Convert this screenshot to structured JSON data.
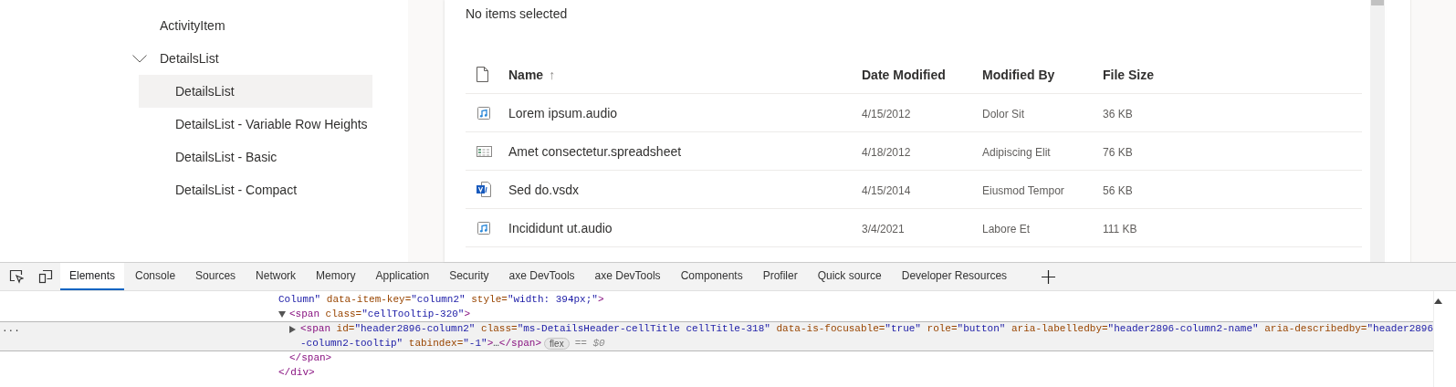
{
  "nav": {
    "items": [
      {
        "label": "ActivityItem",
        "selected": false
      },
      {
        "label": "DetailsList",
        "selected": false,
        "expanded": true,
        "children": [
          {
            "label": "DetailsList",
            "selected": true
          },
          {
            "label": "DetailsList - Variable Row Heights",
            "selected": false
          },
          {
            "label": "DetailsList - Basic",
            "selected": false
          },
          {
            "label": "DetailsList - Compact",
            "selected": false
          }
        ]
      }
    ]
  },
  "content": {
    "selection_status": "No items selected",
    "table": {
      "columns": [
        {
          "label": "Name",
          "sort_glyph": "↑"
        },
        {
          "label": "Date Modified"
        },
        {
          "label": "Modified By"
        },
        {
          "label": "File Size"
        }
      ],
      "rows": [
        {
          "kind": "audio",
          "cells": [
            "Lorem ipsum.audio",
            "4/15/2012",
            "Dolor Sit",
            "36 KB"
          ]
        },
        {
          "kind": "spreadsheet",
          "cells": [
            "Amet consectetur.spreadsheet",
            "4/18/2012",
            "Adipiscing Elit",
            "76 KB"
          ]
        },
        {
          "kind": "diagram",
          "cells": [
            "Sed do.vsdx",
            "4/15/2014",
            "Eiusmod Tempor",
            "56 KB"
          ]
        },
        {
          "kind": "audio",
          "cells": [
            "Incididunt ut.audio",
            "3/4/2021",
            "Labore Et",
            "111 KB"
          ]
        }
      ]
    }
  },
  "devtools": {
    "tabs": [
      {
        "label": "Elements",
        "selected": true
      },
      {
        "label": "Console",
        "selected": false
      },
      {
        "label": "Sources",
        "selected": false
      },
      {
        "label": "Network",
        "selected": false
      },
      {
        "label": "Memory",
        "selected": false
      },
      {
        "label": "Application",
        "selected": false
      },
      {
        "label": "Security",
        "selected": false
      },
      {
        "label": "axe DevTools",
        "selected": false
      },
      {
        "label": "axe DevTools",
        "selected": false
      },
      {
        "label": "Components",
        "selected": false
      },
      {
        "label": "Profiler",
        "selected": false
      },
      {
        "label": "Quick source",
        "selected": false
      },
      {
        "label": "Developer Resources",
        "selected": false
      }
    ],
    "gutter": "...",
    "dom": {
      "lines": [
        [
          {
            "kind": "value",
            "text": "Column\""
          },
          {
            "kind": "attr",
            "text": " data-item-key="
          },
          {
            "kind": "value",
            "text": "\"column2\""
          },
          {
            "kind": "attr",
            "text": " style="
          },
          {
            "kind": "value",
            "text": "\"width: 394px;\""
          },
          {
            "kind": "tag",
            "text": ">"
          }
        ]
      ],
      "children": [
        {
          "expanded": true,
          "selected": false,
          "lines": [
            [
              {
                "kind": "tag",
                "text": "<span"
              },
              {
                "kind": "attr",
                "text": " class="
              },
              {
                "kind": "value",
                "text": "\"cellTooltip-320\""
              },
              {
                "kind": "tag",
                "text": ">"
              }
            ]
          ],
          "children": [
            {
              "expanded": false,
              "selected": true,
              "badge": "flex",
              "suffix": "== $0",
              "lines": [
                [
                  {
                    "kind": "tag",
                    "text": "<span"
                  },
                  {
                    "kind": "attr",
                    "text": " id="
                  },
                  {
                    "kind": "value",
                    "text": "\"header2896-column2\""
                  },
                  {
                    "kind": "attr",
                    "text": " class="
                  },
                  {
                    "kind": "value",
                    "text": "\"ms-DetailsHeader-cellTitle cellTitle-318\""
                  },
                  {
                    "kind": "attr",
                    "text": " data-is-focusable="
                  },
                  {
                    "kind": "value",
                    "text": "\"true\""
                  },
                  {
                    "kind": "attr",
                    "text": " role="
                  },
                  {
                    "kind": "value",
                    "text": "\"button\""
                  },
                  {
                    "kind": "attr",
                    "text": " aria-labelledby="
                  },
                  {
                    "kind": "value",
                    "text": "\"header2896-column2-name\""
                  },
                  {
                    "kind": "attr",
                    "text": " aria-describedby="
                  },
                  {
                    "kind": "value",
                    "text": "\"header2896"
                  }
                ],
                [
                  {
                    "kind": "value",
                    "text": "-column2-tooltip\""
                  },
                  {
                    "kind": "attr",
                    "text": " tabindex="
                  },
                  {
                    "kind": "value",
                    "text": "\"-1\""
                  },
                  {
                    "kind": "tag",
                    "text": ">"
                  },
                  {
                    "kind": "text",
                    "text": "…"
                  },
                  {
                    "kind": "tag",
                    "text": "</span>"
                  }
                ]
              ]
            }
          ],
          "close": [
            {
              "kind": "tag",
              "text": "</span>"
            }
          ]
        }
      ],
      "close": [
        {
          "kind": "tag",
          "text": "</div>"
        }
      ]
    }
  }
}
